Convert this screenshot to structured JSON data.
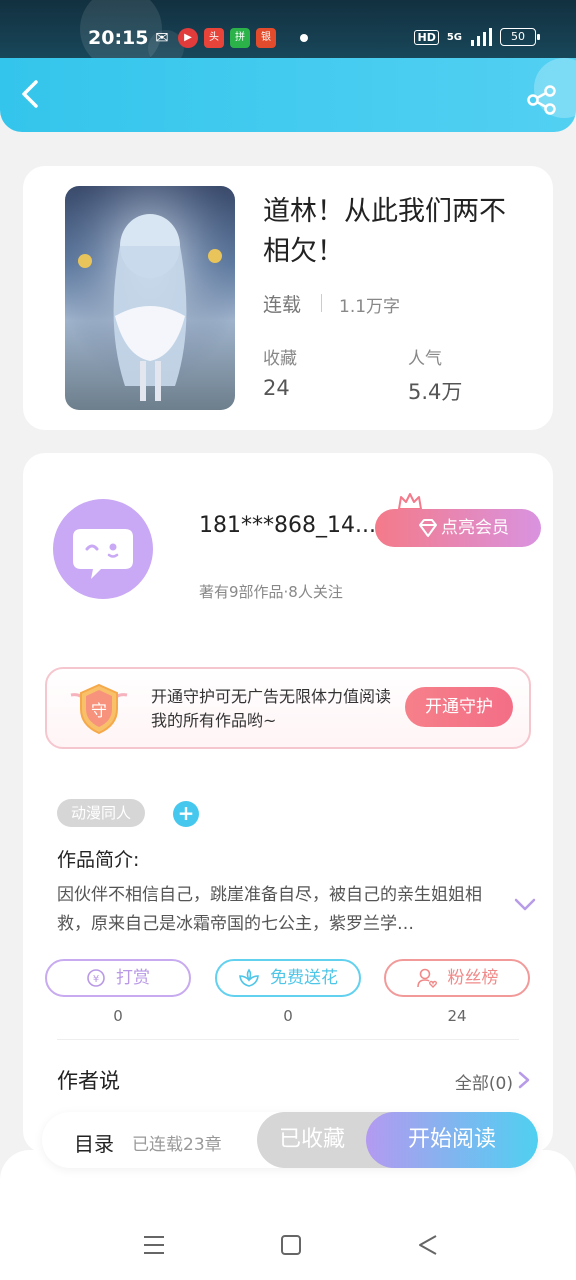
{
  "status_bar": {
    "time": "20:15",
    "hd": "HD",
    "network": "5G",
    "battery": "50",
    "apps": [
      {
        "name": "wechat-icon",
        "glyph": "✉",
        "color": "#12303f"
      },
      {
        "name": "video-app-icon",
        "glyph": "▶",
        "color": "#e23b3b"
      },
      {
        "name": "news-app-icon",
        "glyph": "头",
        "color": "#e8443a"
      },
      {
        "name": "shopping-app-icon",
        "glyph": "拼",
        "color": "#2bb34a"
      },
      {
        "name": "bank-app-icon",
        "glyph": "银",
        "color": "#e24b2b"
      }
    ]
  },
  "book": {
    "title": "道林！从此我们两不相欠！",
    "status": "连载",
    "words": "1.1万字",
    "collect_label": "收藏",
    "collect_value": "24",
    "popularity_label": "人气",
    "popularity_value": "5.4万"
  },
  "author": {
    "name": "181***868_14...",
    "meta": "著有9部作品·8人关注",
    "vip_label": "点亮会员"
  },
  "guard": {
    "text": "开通守护可无广告无限体力值阅读我的所有作品哟~",
    "button": "开通守护",
    "shield_char": "守"
  },
  "tags": {
    "items": [
      "动漫同人"
    ],
    "add": "+"
  },
  "intro": {
    "title": "作品简介:",
    "text": "因伙伴不相信自己，跳崖准备自尽，被自己的亲生姐姐相救，原来自己是冰霜帝国的七公主，紫罗兰学…"
  },
  "actions": [
    {
      "label": "打赏",
      "count": "0",
      "color": "#b999e6"
    },
    {
      "label": "免费送花",
      "count": "0",
      "color": "#4fc6e8"
    },
    {
      "label": "粉丝榜",
      "count": "24",
      "color": "#f08a8a"
    }
  ],
  "author_says": {
    "title": "作者说",
    "all": "全部(0)"
  },
  "bottom_bar": {
    "toc": "目录",
    "toc_sub": "已连载23章",
    "collected": "已收藏",
    "read": "开始阅读"
  }
}
